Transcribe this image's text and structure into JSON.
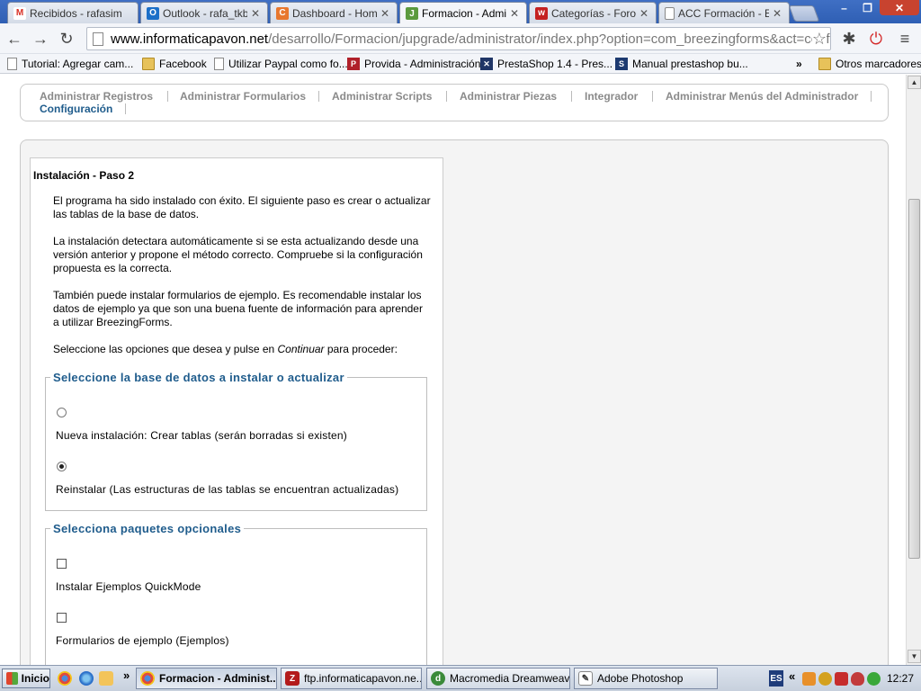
{
  "browser": {
    "tabs": [
      {
        "label": "Recibidos - rafasim",
        "icon": "gmail-icon",
        "color": "#d93025",
        "glyph": "M"
      },
      {
        "label": "Outlook - rafa_tkb",
        "icon": "outlook-icon",
        "color": "#1b6fc8",
        "glyph": "O"
      },
      {
        "label": "Dashboard - Home",
        "icon": "dashboard-icon",
        "color": "#e8772e",
        "glyph": "C"
      },
      {
        "label": "Formacion - Admin",
        "icon": "joomla-icon",
        "color": "#5b9a3e",
        "glyph": "J"
      },
      {
        "label": "Categorías - Foro",
        "icon": "forum-icon",
        "color": "#c42121",
        "glyph": "w"
      },
      {
        "label": "ACC Formación - E",
        "icon": "page-icon",
        "color": "#ffffff",
        "glyph": ""
      }
    ],
    "url_host": "www.informaticapavon.net",
    "url_path": "/desarrollo/Formacion/jupgrade/administrator/index.php?option=com_breezingforms&act=configura",
    "bookmarks": [
      {
        "label": "Tutorial: Agregar cam...",
        "icon": "page"
      },
      {
        "label": "Facebook",
        "icon": "folder"
      },
      {
        "label": "Utilizar Paypal como fo...",
        "icon": "page"
      },
      {
        "label": "Provida - Administración",
        "icon": "provida"
      },
      {
        "label": "PrestaShop 1.4 - Pres...",
        "icon": "prestashop"
      },
      {
        "label": "Manual prestashop bu...",
        "icon": "s"
      }
    ],
    "bookmarks_overflow": "»",
    "other_bookmarks": "Otros marcadores"
  },
  "menu": {
    "items": [
      "Administrar Registros",
      "Administrar Formularios",
      "Administrar Scripts",
      "Administrar Piezas",
      "Integrador",
      "Administrar Menús del Administrador"
    ],
    "current": "Configuración"
  },
  "install": {
    "title": "Instalación - Paso 2",
    "p1": "El programa ha sido instalado con éxito. El siguiente paso es crear o actualizar las tablas de la base de datos.",
    "p2": "La instalación detectara automáticamente si se esta actualizando desde una versión anterior y propone el método correcto. Compruebe si la configuración propuesta es la correcta.",
    "p3": "También puede instalar formularios de ejemplo. Es recomendable instalar los datos de ejemplo ya que son una buena fuente de información para aprender a utilizar BreezingForms.",
    "p4_before": "Seleccione las opciones que desea y pulse en ",
    "p4_em": "Continuar",
    "p4_after": " para proceder:",
    "db_legend": "Seleccione la base de datos a instalar o actualizar",
    "db_options": [
      {
        "label": "Nueva instalación: Crear tablas (serán borradas si existen)",
        "selected": false
      },
      {
        "label": "Reinstalar (Las estructuras de las tablas se encuentran actualizadas)",
        "selected": true
      }
    ],
    "pkg_legend": "Selecciona paquetes opcionales",
    "pkg_options": [
      {
        "label": "Instalar Ejemplos QuickMode",
        "checked": false
      },
      {
        "label": "Formularios de ejemplo (Ejemplos)",
        "checked": false
      }
    ]
  },
  "taskbar": {
    "start": "Inicio",
    "overflow": "»",
    "buttons": [
      {
        "label": "Formacion - Administ...",
        "icon": "chrome-icon",
        "active": true
      },
      {
        "label": "ftp.informaticapavon.ne...",
        "icon": "filezilla-icon",
        "active": false
      },
      {
        "label": "Macromedia Dreamweav...",
        "icon": "dreamweaver-icon",
        "active": false
      },
      {
        "label": "Adobe Photoshop",
        "icon": "photoshop-icon",
        "active": false
      }
    ],
    "lang": "ES",
    "tray_chevron": "«",
    "clock": "12:27"
  }
}
